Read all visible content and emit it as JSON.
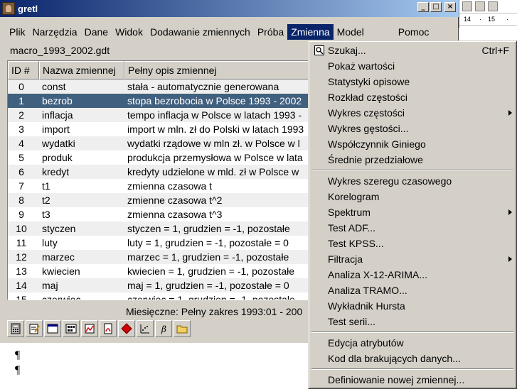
{
  "window": {
    "title": "gretl"
  },
  "background_doc": {
    "ruler_marks": [
      "14",
      "·",
      "15",
      "·"
    ]
  },
  "menubar": [
    "Plik",
    "Narzędzia",
    "Dane",
    "Widok",
    "Dodawanie zmiennych",
    "Próba",
    "Zmienna",
    "Model",
    "Pomoc"
  ],
  "file_label": "macro_1993_2002.gdt",
  "table": {
    "headers": [
      "ID #",
      "Nazwa zmiennej",
      "Pełny opis zmiennej"
    ],
    "rows": [
      {
        "id": "0",
        "name": "const",
        "desc": "stała - automatycznie generowana"
      },
      {
        "id": "1",
        "name": "bezrob",
        "desc": "stopa bezrobocia w Polsce 1993 - 2002"
      },
      {
        "id": "2",
        "name": "inflacja",
        "desc": "tempo inflacja w Polsce w latach 1993 -"
      },
      {
        "id": "3",
        "name": "import",
        "desc": "import w mln. zł do Polski w latach 1993"
      },
      {
        "id": "4",
        "name": "wydatki",
        "desc": "wydatki rządowe w mln zł. w Polsce w l"
      },
      {
        "id": "5",
        "name": "produk",
        "desc": "produkcja przemysłowa w Polsce w lata"
      },
      {
        "id": "6",
        "name": "kredyt",
        "desc": "kredyty udzielone w mld. zł w Polsce w"
      },
      {
        "id": "7",
        "name": "t1",
        "desc": "zmienna czasowa t"
      },
      {
        "id": "8",
        "name": "t2",
        "desc": "zmienne czasowa t^2"
      },
      {
        "id": "9",
        "name": "t3",
        "desc": "zmienna czasowa t^3"
      },
      {
        "id": "10",
        "name": "styczen",
        "desc": "styczen = 1, grudzien = -1, pozostałe"
      },
      {
        "id": "11",
        "name": "luty",
        "desc": "luty = 1, grudzien = -1, pozostałe = 0"
      },
      {
        "id": "12",
        "name": "marzec",
        "desc": "marzec = 1, grudzien = -1, pozostałe"
      },
      {
        "id": "13",
        "name": "kwiecien",
        "desc": "kwiecien = 1, grudzien = -1, pozostałe"
      },
      {
        "id": "14",
        "name": "maj",
        "desc": "maj = 1, grudzien = -1, pozostałe = 0"
      },
      {
        "id": "15",
        "name": "czerwiec",
        "desc": "czerwiec = 1, grudzien = -1, pozostałe"
      }
    ]
  },
  "status": "Miesięczne: Pełny zakres 1993:01 - 200",
  "toolbar_icons": [
    "calculator-icon",
    "notepad-icon",
    "console-icon",
    "session-icon",
    "plot-icon",
    "pdf-icon",
    "help-icon",
    "graph-icon",
    "beta-icon",
    "folder-icon"
  ],
  "doc_pilcrows": [
    "¶",
    "¶"
  ],
  "dropdown": {
    "groups": [
      [
        {
          "label": "Szukaj...",
          "shortcut": "Ctrl+F",
          "icon": "search-icon"
        },
        {
          "label": "Pokaż wartości"
        },
        {
          "label": "Statystyki opisowe"
        },
        {
          "label": "Rozkład częstości"
        },
        {
          "label": "Wykres częstości",
          "submenu": true
        },
        {
          "label": "Wykres gęstości..."
        },
        {
          "label": "Współczynnik Giniego"
        },
        {
          "label": "Średnie przedziałowe"
        }
      ],
      [
        {
          "label": "Wykres szeregu czasowego"
        },
        {
          "label": "Korelogram"
        },
        {
          "label": "Spektrum",
          "submenu": true
        },
        {
          "label": "Test ADF..."
        },
        {
          "label": "Test KPSS..."
        },
        {
          "label": "Filtracja",
          "submenu": true
        },
        {
          "label": "Analiza X-12-ARIMA..."
        },
        {
          "label": "Analiza TRAMO..."
        },
        {
          "label": "Wykładnik Hursta"
        },
        {
          "label": "Test serii..."
        }
      ],
      [
        {
          "label": "Edycja atrybutów"
        },
        {
          "label": "Kod dla brakujących danych..."
        }
      ],
      [
        {
          "label": "Definiowanie nowej zmiennej..."
        }
      ]
    ]
  },
  "colors": {
    "selection": "#40607f",
    "menu_active": "#0a246a",
    "window_bg": "#d4d0c8"
  }
}
